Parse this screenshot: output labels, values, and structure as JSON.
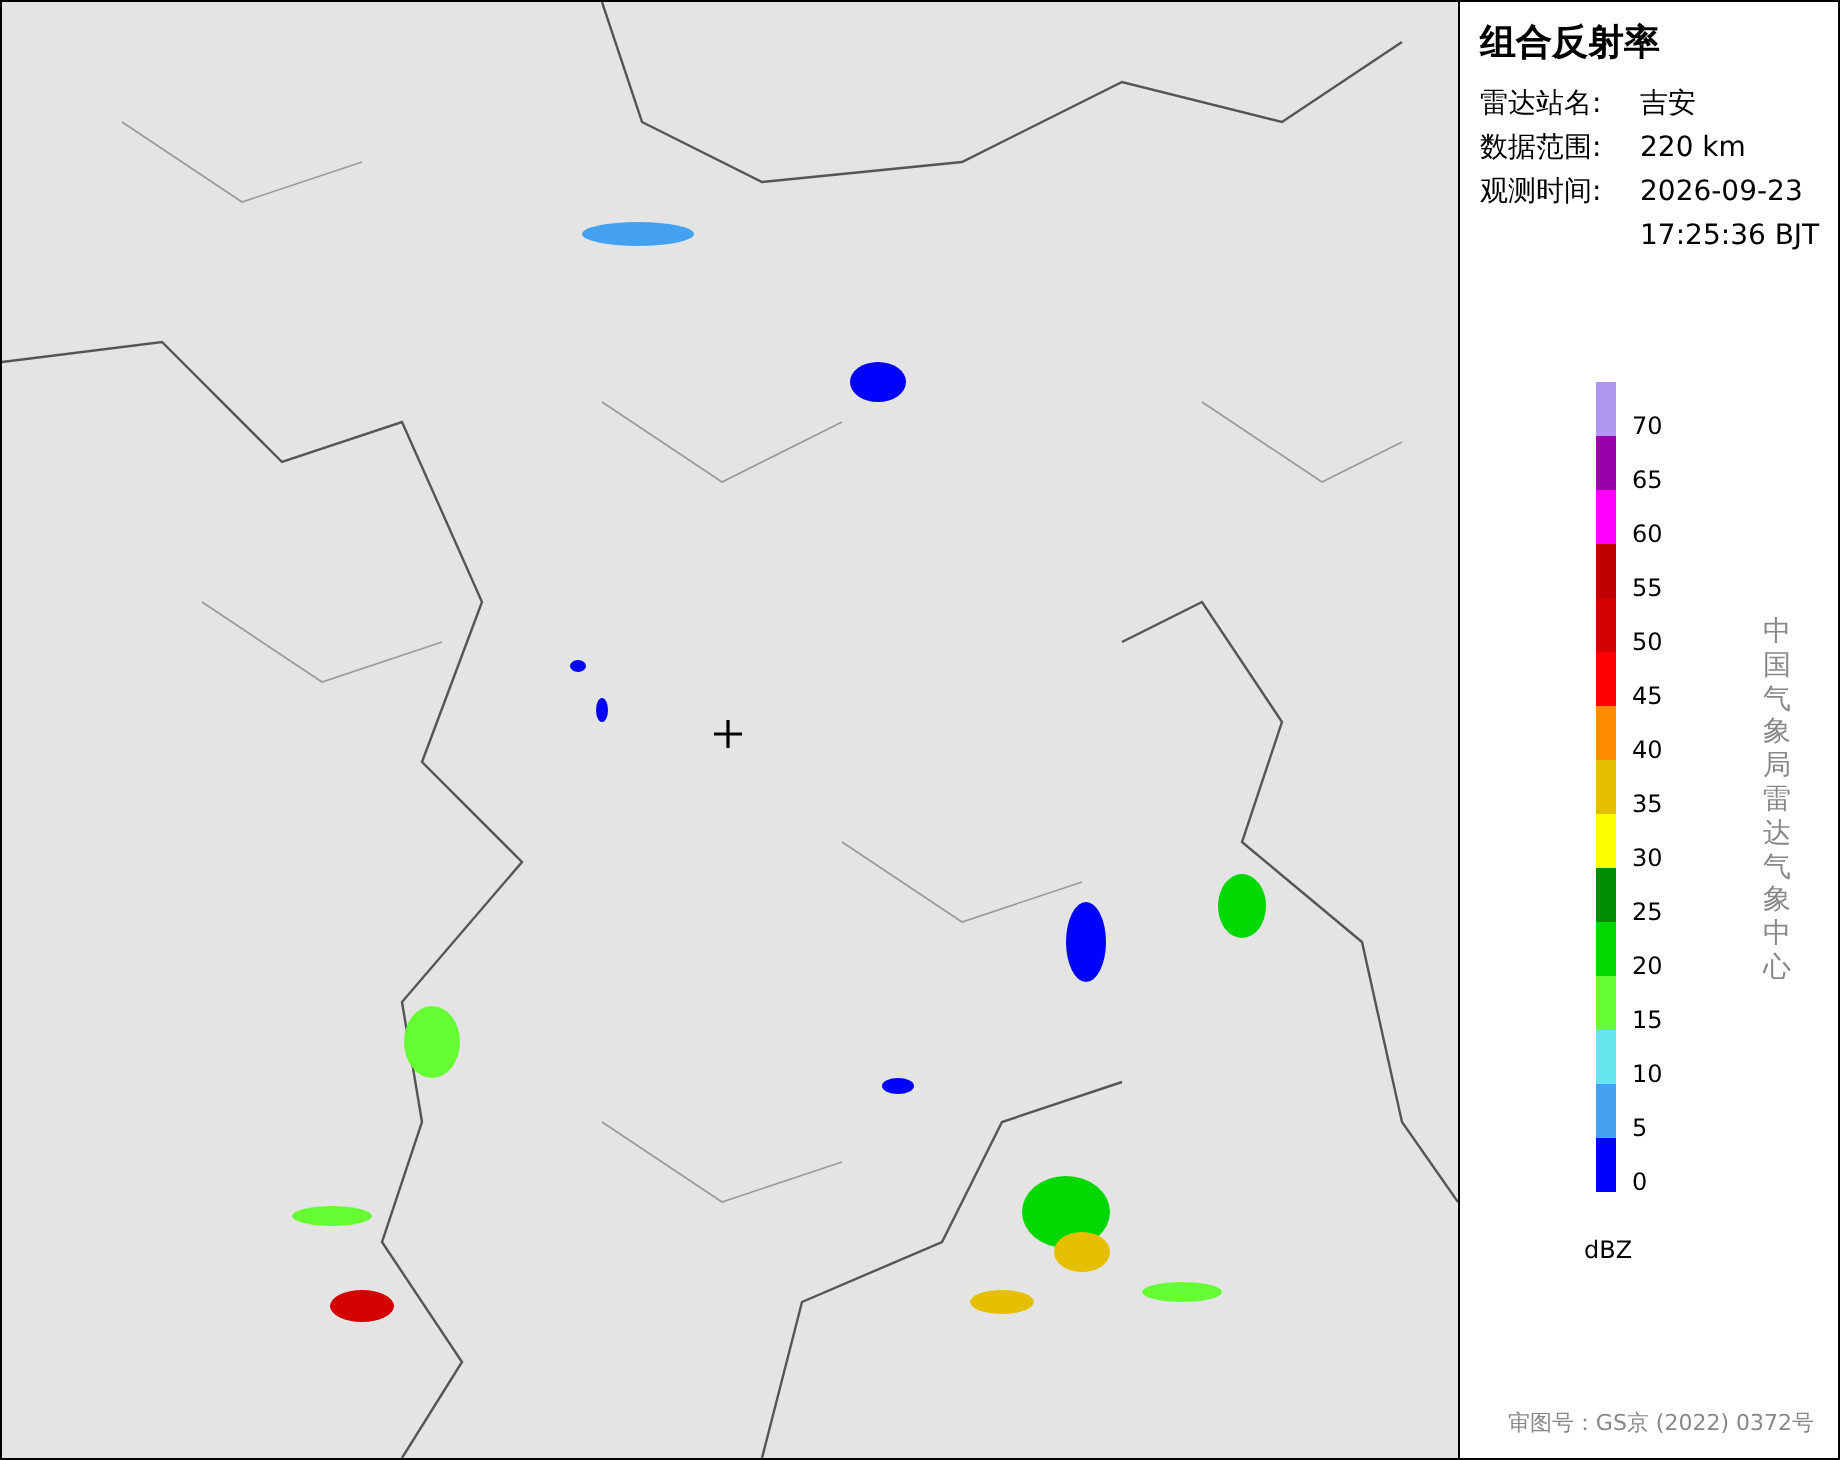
{
  "title": "组合反射率",
  "info": [
    {
      "label": "雷达站名:",
      "value": "吉安"
    },
    {
      "label": "数据范围:",
      "value": "220 km"
    },
    {
      "label": "观测时间:",
      "value": "2026-09-23",
      "value2": "17:25:36 BJT"
    }
  ],
  "legend": {
    "unit": "dBZ",
    "items": [
      {
        "color": "#b197f0",
        "label": "70"
      },
      {
        "color": "#9900aa",
        "label": "65"
      },
      {
        "color": "#ff00ff",
        "label": "60"
      },
      {
        "color": "#c00000",
        "label": "55"
      },
      {
        "color": "#d40000",
        "label": "50"
      },
      {
        "color": "#ff0000",
        "label": "45"
      },
      {
        "color": "#ff8c00",
        "label": "40"
      },
      {
        "color": "#e6c000",
        "label": "35"
      },
      {
        "color": "#ffff00",
        "label": "30"
      },
      {
        "color": "#008c00",
        "label": "25"
      },
      {
        "color": "#00d800",
        "label": "20"
      },
      {
        "color": "#66ff33",
        "label": "15"
      },
      {
        "color": "#66e6ee",
        "label": "10"
      },
      {
        "color": "#44a0f0",
        "label": "5"
      },
      {
        "color": "#0000ff",
        "label": "0"
      }
    ]
  },
  "credit": "中国气象局雷达气象中心",
  "approval": "审图号：GS京 (2022) 0372号"
}
